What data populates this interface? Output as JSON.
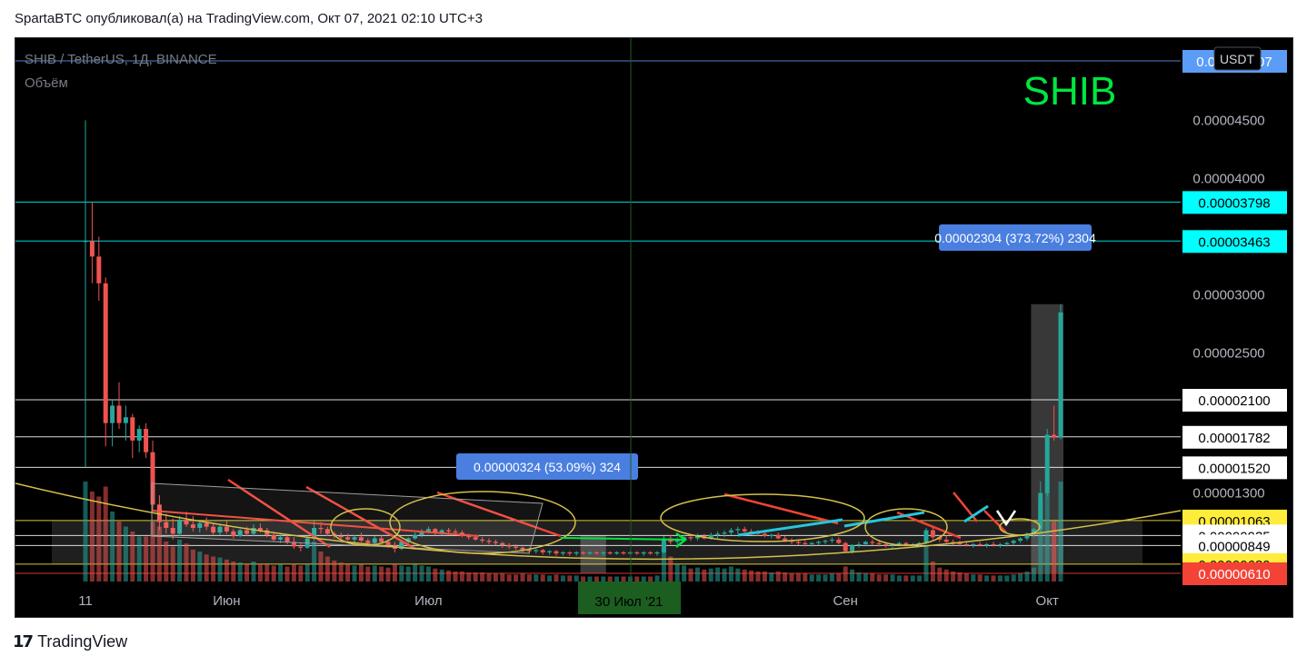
{
  "header": {
    "published": "SpartaBTC опубликовал(а) на TradingView.com, Окт 07, 2021 02:10 UTC+3"
  },
  "footer": {
    "logo_icon": "tradingview-logo-icon",
    "brand": "TradingView"
  },
  "chart": {
    "symbol_line": "SHIB / TetherUS, 1Д, BINANCE",
    "volume_label": "Объём",
    "watermark": "SHIB",
    "currency_badge": "USDT",
    "crosshair_date": "30 Июл '21",
    "colors": {
      "up": "#26a69a",
      "down": "#ef5350",
      "background": "#000000",
      "watermark": "#00e640"
    }
  },
  "chart_data": {
    "type": "candlestick",
    "symbol": "SHIBUSDT",
    "exchange": "BINANCE",
    "timeframe": "1D",
    "ylim": [
      6.1e-06,
      5.01e-05
    ],
    "price_axis_ticks": [
      "0.00004500",
      "0.00004000",
      "0.00003000",
      "0.00002500",
      "0.00001300"
    ],
    "price_tick_values": [
      4.5e-05,
      4e-05,
      3e-05,
      2.5e-05,
      1.3e-05
    ],
    "time_axis_ticks": [
      "11",
      "Июн",
      "Июл",
      "Сен",
      "Окт"
    ],
    "time_tick_index": [
      0,
      21,
      51,
      113,
      143
    ],
    "horizontal_levels": [
      {
        "label": "0.000050 07",
        "value": 5.01e-05,
        "color": "#5b9cf6",
        "text_color": "#ffffff"
      },
      {
        "label": "0.00003798",
        "value": 3.798e-05,
        "color": "#00ffff",
        "text_color": "#000000"
      },
      {
        "label": "0.00003463",
        "value": 3.463e-05,
        "color": "#00ffff",
        "text_color": "#000000"
      },
      {
        "label": "0.00002100",
        "value": 2.1e-05,
        "color": "#ffffff",
        "text_color": "#000000"
      },
      {
        "label": "0.00001782",
        "value": 1.782e-05,
        "color": "#ffffff",
        "text_color": "#000000"
      },
      {
        "label": "0.00001520",
        "value": 1.52e-05,
        "color": "#ffffff",
        "text_color": "#000000"
      },
      {
        "label": "0.00001063",
        "value": 1.063e-05,
        "color": "#ffeb3b",
        "text_color": "#000000"
      },
      {
        "label": "0.00000935",
        "value": 9.35e-06,
        "color": "#ffffff",
        "text_color": "#000000"
      },
      {
        "label": "0.00000849",
        "value": 8.49e-06,
        "color": "#ffffff",
        "text_color": "#000000"
      },
      {
        "label": "0.00000689",
        "value": 6.89e-06,
        "color": "#ffeb3b",
        "text_color": "#000000"
      },
      {
        "label": "0.00000610",
        "value": 6.1e-06,
        "color": "#f44336",
        "text_color": "#ffffff"
      }
    ],
    "measurements": [
      {
        "label": "0.00002304 (373.72%) 2304",
        "from_index": 141,
        "to_index": 145,
        "from_value": 6.17e-06,
        "to_value": 2.921e-05
      },
      {
        "label": "0.00000324 (53.09%) 324",
        "from_index": 74,
        "to_index": 77,
        "from_value": 6.1e-06,
        "to_value": 9.34e-06
      }
    ],
    "candles": [
      [
        3.463e-05,
        4.5e-05,
        1.52e-05,
        3.463e-05,
        1.0
      ],
      [
        3.463e-05,
        3.798e-05,
        3.1e-05,
        3.33e-05,
        0.9
      ],
      [
        3.33e-05,
        3.5e-05,
        2.95e-05,
        3.1e-05,
        0.85
      ],
      [
        3.1e-05,
        3.15e-05,
        1.7e-05,
        1.9e-05,
        0.95
      ],
      [
        1.9e-05,
        2.1e-05,
        1.7e-05,
        2.05e-05,
        0.7
      ],
      [
        2.05e-05,
        2.25e-05,
        1.85e-05,
        1.9e-05,
        0.6
      ],
      [
        1.9e-05,
        2.05e-05,
        1.75e-05,
        1.95e-05,
        0.55
      ],
      [
        1.95e-05,
        1.98e-05,
        1.6e-05,
        1.75e-05,
        0.5
      ],
      [
        1.75e-05,
        1.88e-05,
        1.65e-05,
        1.85e-05,
        0.45
      ],
      [
        1.85e-05,
        1.9e-05,
        1.6e-05,
        1.65e-05,
        0.45
      ],
      [
        1.65e-05,
        1.75e-05,
        1.15e-05,
        1.2e-05,
        0.6
      ],
      [
        1.2e-05,
        1.28e-05,
        9.8e-06,
        1.05e-05,
        0.55
      ],
      [
        1.05e-05,
        1.12e-05,
        9.5e-06,
        1e-05,
        0.4
      ],
      [
        1e-05,
        1.08e-05,
        9e-06,
        9.5e-06,
        0.35
      ],
      [
        9.5e-06,
        1.1e-05,
        9.3e-06,
        1.07e-05,
        0.42
      ],
      [
        1.07e-05,
        1.14e-05,
        1.01e-05,
        1.03e-05,
        0.38
      ],
      [
        1.03e-05,
        1.1e-05,
        9.7e-06,
        1e-05,
        0.32
      ],
      [
        1e-05,
        1.07e-05,
        9.6e-06,
        1.04e-05,
        0.3
      ],
      [
        1.04e-05,
        1.09e-05,
        9.8e-06,
        1.01e-05,
        0.27
      ],
      [
        1.01e-05,
        1.04e-05,
        9.4e-06,
        9.6e-06,
        0.25
      ],
      [
        9.6e-06,
        1.03e-05,
        9.4e-06,
        1.01e-05,
        0.24
      ],
      [
        1.01e-05,
        1.06e-05,
        9.5e-06,
        9.7e-06,
        0.22
      ],
      [
        9.7e-06,
        9.9e-06,
        9.1e-06,
        9.3e-06,
        0.2
      ],
      [
        9.3e-06,
        9.9e-06,
        9.2e-06,
        9.8e-06,
        0.19
      ],
      [
        9.8e-06,
        1.01e-05,
        9.3e-06,
        9.5e-06,
        0.18
      ],
      [
        9.5e-06,
        1.03e-05,
        9.3e-06,
        1e-05,
        0.2
      ],
      [
        1e-05,
        1.04e-05,
        9.6e-06,
        9.8e-06,
        0.18
      ],
      [
        9.8e-06,
        1e-05,
        9.2e-06,
        9.4e-06,
        0.17
      ],
      [
        9.4e-06,
        9.6e-06,
        8.8e-06,
        9e-06,
        0.16
      ],
      [
        9e-06,
        9.5e-06,
        8.7e-06,
        9.2e-06,
        0.17
      ],
      [
        9.2e-06,
        9.4e-06,
        8.6e-06,
        8.8e-06,
        0.15
      ],
      [
        8.8e-06,
        9.2e-06,
        8.2e-06,
        8.4e-06,
        0.18
      ],
      [
        8.4e-06,
        8.7e-06,
        8e-06,
        8.3e-06,
        0.16
      ],
      [
        8.3e-06,
        9.2e-06,
        8.2e-06,
        9.1e-06,
        0.17
      ],
      [
        9.1e-06,
        1.06e-05,
        8.9e-06,
        1e-05,
        0.4
      ],
      [
        1e-05,
        1.05e-05,
        9.5e-06,
        9.9e-06,
        0.3
      ],
      [
        9.9e-06,
        1.01e-05,
        9.3e-06,
        9.5e-06,
        0.25
      ],
      [
        9.5e-06,
        9.7e-06,
        9.1e-06,
        9.3e-06,
        0.21
      ],
      [
        9.3e-06,
        9.6e-06,
        9e-06,
        9.2e-06,
        0.19
      ],
      [
        9.2e-06,
        9.5e-06,
        8.9e-06,
        9e-06,
        0.17
      ],
      [
        9e-06,
        9.4e-06,
        8.7e-06,
        9.2e-06,
        0.16
      ],
      [
        9.2e-06,
        9.6e-06,
        8.8e-06,
        8.9e-06,
        0.17
      ],
      [
        8.9e-06,
        9.1e-06,
        8.5e-06,
        8.7e-06,
        0.15
      ],
      [
        8.7e-06,
        9.3e-06,
        8.6e-06,
        9.1e-06,
        0.16
      ],
      [
        9.1e-06,
        9.4e-06,
        8.7e-06,
        8.8e-06,
        0.15
      ],
      [
        8.8e-06,
        9e-06,
        8.3e-06,
        8.5e-06,
        0.14
      ],
      [
        8.5e-06,
        8.8e-06,
        7.9e-06,
        8.2e-06,
        0.18
      ],
      [
        8.2e-06,
        8.9e-06,
        8.1e-06,
        8.8e-06,
        0.16
      ],
      [
        8.8e-06,
        9.2e-06,
        8.6e-06,
        9.1e-06,
        0.15
      ],
      [
        9.1e-06,
        9.6e-06,
        9e-06,
        9.4e-06,
        0.17
      ],
      [
        9.4e-06,
        9.9e-06,
        9.2e-06,
        9.7e-06,
        0.16
      ],
      [
        9.7e-06,
        1.01e-05,
        9.5e-06,
        9.9e-06,
        0.15
      ],
      [
        9.9e-06,
        1e-05,
        9.4e-06,
        9.6e-06,
        0.13
      ],
      [
        9.6e-06,
        9.9e-06,
        9.4e-06,
        9.8e-06,
        0.12
      ],
      [
        9.8e-06,
        1e-05,
        9.5e-06,
        9.7e-06,
        0.11
      ],
      [
        9.7e-06,
        9.9e-06,
        9.4e-06,
        9.6e-06,
        0.1
      ],
      [
        9.6e-06,
        9.8e-06,
        9.2e-06,
        9.3e-06,
        0.1
      ],
      [
        9.3e-06,
        9.5e-06,
        9e-06,
        9.2e-06,
        0.09
      ],
      [
        9.2e-06,
        9.4e-06,
        8.9e-06,
        9e-06,
        0.09
      ],
      [
        9e-06,
        9.2e-06,
        8.7e-06,
        8.9e-06,
        0.09
      ],
      [
        8.9e-06,
        9.1e-06,
        8.6e-06,
        8.8e-06,
        0.08
      ],
      [
        8.8e-06,
        9e-06,
        8.5e-06,
        8.7e-06,
        0.08
      ],
      [
        8.7e-06,
        8.8e-06,
        8.3e-06,
        8.5e-06,
        0.08
      ],
      [
        8.5e-06,
        8.7e-06,
        8.2e-06,
        8.4e-06,
        0.07
      ],
      [
        8.4e-06,
        8.6e-06,
        8.1e-06,
        8.3e-06,
        0.07
      ],
      [
        8.3e-06,
        8.4e-06,
        7.9e-06,
        8.1e-06,
        0.08
      ],
      [
        8.1e-06,
        8.3e-06,
        7.8e-06,
        8e-06,
        0.07
      ],
      [
        8e-06,
        8.2e-06,
        7.8e-06,
        8.1e-06,
        0.07
      ],
      [
        8.1e-06,
        8.2e-06,
        7.7e-06,
        7.9e-06,
        0.07
      ],
      [
        7.9e-06,
        8.1e-06,
        7.7e-06,
        8e-06,
        0.06
      ],
      [
        8e-06,
        8.1e-06,
        7.6e-06,
        7.8e-06,
        0.07
      ],
      [
        7.8e-06,
        8e-06,
        7.6e-06,
        7.9e-06,
        0.06
      ],
      [
        7.9e-06,
        8e-06,
        7.6e-06,
        7.8e-06,
        0.06
      ],
      [
        7.8e-06,
        8e-06,
        7.6e-06,
        7.9e-06,
        0.06
      ],
      [
        7.9e-06,
        8e-06,
        7.7e-06,
        7.8e-06,
        0.05
      ],
      [
        7.8e-06,
        8e-06,
        7.7e-06,
        7.9e-06,
        0.05
      ],
      [
        7.9e-06,
        8e-06,
        7.7e-06,
        7.8e-06,
        0.05
      ],
      [
        7.8e-06,
        8e-06,
        7.6e-06,
        7.9e-06,
        0.05
      ],
      [
        7.9e-06,
        8e-06,
        7.7e-06,
        7.8e-06,
        0.05
      ],
      [
        7.8e-06,
        8e-06,
        7.7e-06,
        7.9e-06,
        0.05
      ],
      [
        7.9e-06,
        8e-06,
        7.7e-06,
        7.8e-06,
        0.05
      ],
      [
        7.8e-06,
        8e-06,
        7.7e-06,
        7.9e-06,
        0.05
      ],
      [
        7.9e-06,
        8e-06,
        7.7e-06,
        7.8e-06,
        0.05
      ],
      [
        7.8e-06,
        8e-06,
        7.6e-06,
        7.9e-06,
        0.05
      ],
      [
        7.9e-06,
        8e-06,
        7.7e-06,
        7.8e-06,
        0.05
      ],
      [
        7.8e-06,
        8e-06,
        7.6e-06,
        7.9e-06,
        0.06
      ],
      [
        7.9e-06,
        9.3e-06,
        7.8e-06,
        9.1e-06,
        0.35
      ],
      [
        9.1e-06,
        9.4e-06,
        8.6e-06,
        8.8e-06,
        0.25
      ],
      [
        8.8e-06,
        9.2e-06,
        8.6e-06,
        9e-06,
        0.17
      ],
      [
        9e-06,
        9.4e-06,
        8.8e-06,
        9.2e-06,
        0.16
      ],
      [
        9.2e-06,
        9.4e-06,
        8.9e-06,
        9.1e-06,
        0.13
      ],
      [
        9.1e-06,
        9.5e-06,
        8.9e-06,
        9.3e-06,
        0.14
      ],
      [
        9.3e-06,
        9.5e-06,
        9e-06,
        9.1e-06,
        0.12
      ],
      [
        9.1e-06,
        9.6e-06,
        9e-06,
        9.4e-06,
        0.13
      ],
      [
        9.4e-06,
        9.7e-06,
        9.1e-06,
        9.5e-06,
        0.14
      ],
      [
        9.5e-06,
        9.8e-06,
        9.2e-06,
        9.6e-06,
        0.13
      ],
      [
        9.6e-06,
        1e-05,
        9.4e-06,
        9.8e-06,
        0.15
      ],
      [
        9.8e-06,
        1.01e-05,
        9.5e-06,
        9.9e-06,
        0.13
      ],
      [
        9.9e-06,
        1.01e-05,
        9.6e-06,
        9.7e-06,
        0.12
      ],
      [
        9.7e-06,
        9.9e-06,
        9.4e-06,
        9.6e-06,
        0.11
      ],
      [
        9.6e-06,
        9.8e-06,
        9.3e-06,
        9.5e-06,
        0.1
      ],
      [
        9.5e-06,
        9.7e-06,
        9.2e-06,
        9.3e-06,
        0.1
      ],
      [
        9.3e-06,
        9.5e-06,
        9.1e-06,
        9.4e-06,
        0.09
      ],
      [
        9.4e-06,
        9.6e-06,
        9e-06,
        9.1e-06,
        0.1
      ],
      [
        9.1e-06,
        9.3e-06,
        8.8e-06,
        8.9e-06,
        0.09
      ],
      [
        8.9e-06,
        9.1e-06,
        8.6e-06,
        8.8e-06,
        0.08
      ],
      [
        8.8e-06,
        9e-06,
        8.5e-06,
        8.7e-06,
        0.08
      ],
      [
        8.7e-06,
        8.9e-06,
        8.4e-06,
        8.6e-06,
        0.08
      ],
      [
        8.6e-06,
        8.8e-06,
        8.4e-06,
        8.7e-06,
        0.07
      ],
      [
        8.7e-06,
        8.9e-06,
        8.5e-06,
        8.8e-06,
        0.07
      ],
      [
        8.8e-06,
        9e-06,
        8.6e-06,
        8.9e-06,
        0.07
      ],
      [
        8.9e-06,
        9.2e-06,
        8.7e-06,
        9e-06,
        0.08
      ],
      [
        9e-06,
        9.2e-06,
        8.6e-06,
        8.7e-06,
        0.08
      ],
      [
        8.7e-06,
        8.8e-06,
        7.9e-06,
        8e-06,
        0.15
      ],
      [
        8e-06,
        8.6e-06,
        7.8e-06,
        8.5e-06,
        0.12
      ],
      [
        8.5e-06,
        8.8e-06,
        8.3e-06,
        8.6e-06,
        0.09
      ],
      [
        8.6e-06,
        8.9e-06,
        8.4e-06,
        8.8e-06,
        0.08
      ],
      [
        8.8e-06,
        9e-06,
        8.5e-06,
        8.7e-06,
        0.08
      ],
      [
        8.7e-06,
        8.9e-06,
        8.4e-06,
        8.6e-06,
        0.07
      ],
      [
        8.6e-06,
        8.8e-06,
        8.3e-06,
        8.5e-06,
        0.07
      ],
      [
        8.5e-06,
        8.7e-06,
        8.3e-06,
        8.6e-06,
        0.07
      ],
      [
        8.6e-06,
        8.8e-06,
        8.4e-06,
        8.7e-06,
        0.06
      ],
      [
        8.7e-06,
        8.8e-06,
        8.4e-06,
        8.5e-06,
        0.06
      ],
      [
        8.5e-06,
        8.7e-06,
        8.3e-06,
        8.6e-06,
        0.06
      ],
      [
        8.6e-06,
        8.8e-06,
        8.4e-06,
        8.7e-06,
        0.06
      ],
      [
        8.7e-06,
        1e-05,
        8.6e-06,
        9.8e-06,
        0.35
      ],
      [
        9.8e-06,
        1.01e-05,
        9e-06,
        9.2e-06,
        0.2
      ],
      [
        9.2e-06,
        9.4e-06,
        8.8e-06,
        9e-06,
        0.14
      ],
      [
        9e-06,
        9.3e-06,
        8.7e-06,
        8.8e-06,
        0.12
      ],
      [
        8.8e-06,
        9e-06,
        8.5e-06,
        8.7e-06,
        0.1
      ],
      [
        8.7e-06,
        8.9e-06,
        8.4e-06,
        8.6e-06,
        0.09
      ],
      [
        8.6e-06,
        8.8e-06,
        8.4e-06,
        8.5e-06,
        0.08
      ],
      [
        8.5e-06,
        8.7e-06,
        8.3e-06,
        8.6e-06,
        0.07
      ],
      [
        8.6e-06,
        8.8e-06,
        8.4e-06,
        8.5e-06,
        0.07
      ],
      [
        8.5e-06,
        8.7e-06,
        8.3e-06,
        8.6e-06,
        0.06
      ],
      [
        8.6e-06,
        8.8e-06,
        8.4e-06,
        8.5e-06,
        0.06
      ],
      [
        8.5e-06,
        8.7e-06,
        8.3e-06,
        8.6e-06,
        0.06
      ],
      [
        8.6e-06,
        8.8e-06,
        8.4e-06,
        8.7e-06,
        0.06
      ],
      [
        8.7e-06,
        9e-06,
        8.5e-06,
        8.9e-06,
        0.07
      ],
      [
        8.9e-06,
        9.2e-06,
        8.7e-06,
        9.1e-06,
        0.08
      ],
      [
        9.1e-06,
        9.6e-06,
        8.9e-06,
        9.5e-06,
        0.1
      ],
      [
        9.5e-06,
        1e-05,
        9.2e-06,
        9.9e-06,
        0.14
      ],
      [
        9.9e-06,
        1.4e-05,
        9.7e-06,
        1.3e-05,
        0.8
      ],
      [
        1.3e-05,
        1.85e-05,
        1.27e-05,
        1.8e-05,
        0.9
      ],
      [
        1.8e-05,
        2.05e-05,
        1.75e-05,
        1.78e-05,
        0.6
      ],
      [
        1.78e-05,
        2.921e-05,
        1.76e-05,
        2.85e-05,
        1.0
      ]
    ]
  }
}
